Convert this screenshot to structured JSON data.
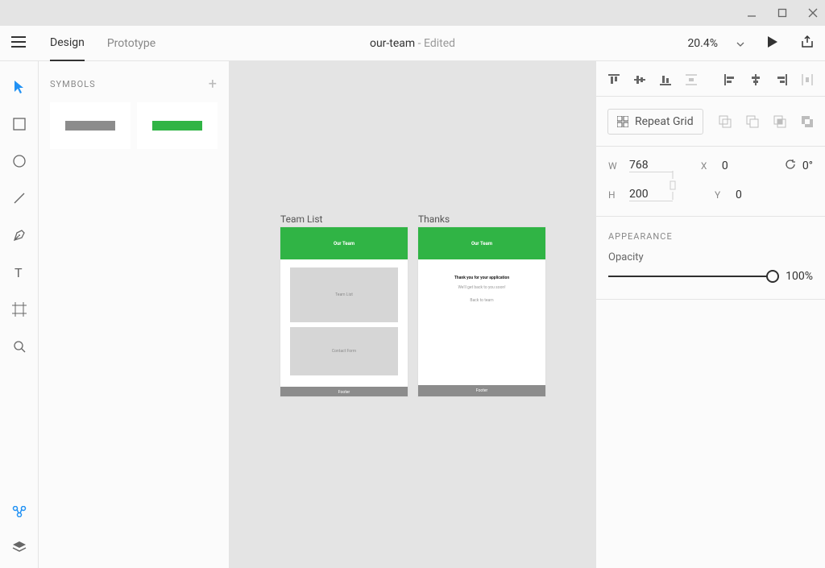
{
  "window": {
    "minimize_label": "minimize",
    "maximize_label": "maximize",
    "close_label": "close"
  },
  "toolbar": {
    "design_tab": "Design",
    "prototype_tab": "Prototype",
    "doc_name": "our-team",
    "edited_suffix": " - Edited",
    "zoom": "20.4%"
  },
  "symbols": {
    "header": "SYMBOLS",
    "item2_label": ""
  },
  "canvas": {
    "ab1": {
      "title": "Team List",
      "header": "Our Team",
      "block1": "Team List",
      "block2": "Contact Form",
      "footer": "Footer"
    },
    "ab2": {
      "title": "Thanks",
      "header": "Our Team",
      "line1": "Thank you for your application",
      "line2": "We'll get back to you soon!",
      "line3": "Back to team",
      "footer": "Footer"
    }
  },
  "inspector": {
    "repeat_grid_label": "Repeat Grid",
    "dims": {
      "w_lbl": "W",
      "w": "768",
      "h_lbl": "H",
      "h": "200",
      "x_lbl": "X",
      "x": "0",
      "y_lbl": "Y",
      "y": "0",
      "rot": "0°"
    },
    "appearance_header": "APPEARANCE",
    "opacity_lbl": "Opacity",
    "opacity_val": "100%"
  }
}
